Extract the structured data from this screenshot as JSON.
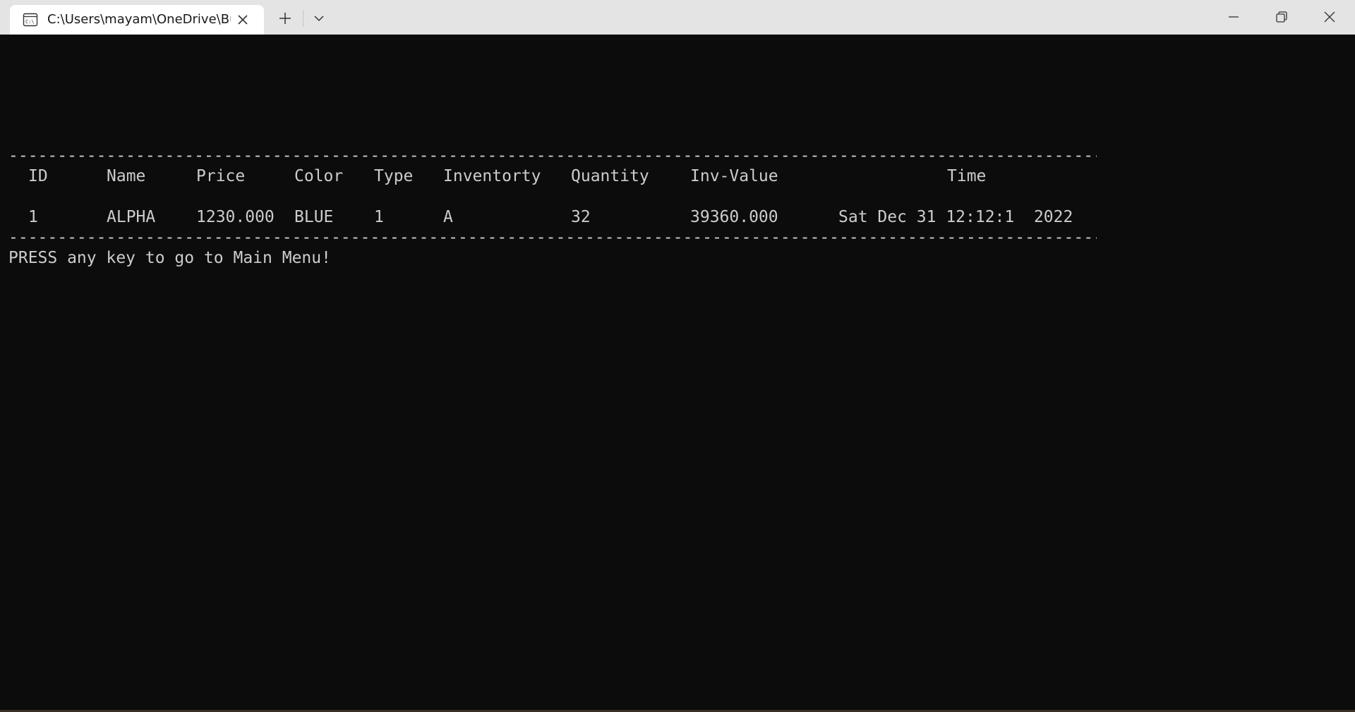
{
  "window": {
    "tab_title": "C:\\Users\\mayam\\OneDrive\\Bu",
    "tab_icon": "terminal-icon",
    "accent": "#e4e4e4",
    "console_bg": "#0c0c0c",
    "console_fg": "#cccccc"
  },
  "console": {
    "separator": "----------------------------------------------------------------------------------------------------------------------",
    "headers": {
      "id": "ID",
      "name": "Name",
      "price": "Price",
      "color": "Color",
      "type": "Type",
      "inventory": "Inventorty",
      "quantity": "Quantity",
      "inv_value": "Inv-Value",
      "time": "Time"
    },
    "rows": [
      {
        "id": "1",
        "name": "ALPHA",
        "price": "1230.000",
        "color": "BLUE",
        "type": "1",
        "inventory": "A",
        "quantity": "32",
        "inv_value": "39360.000",
        "time": "Sat Dec 31 12:12:1  2022"
      }
    ],
    "prompt": "PRESS any key to go to Main Menu!"
  }
}
